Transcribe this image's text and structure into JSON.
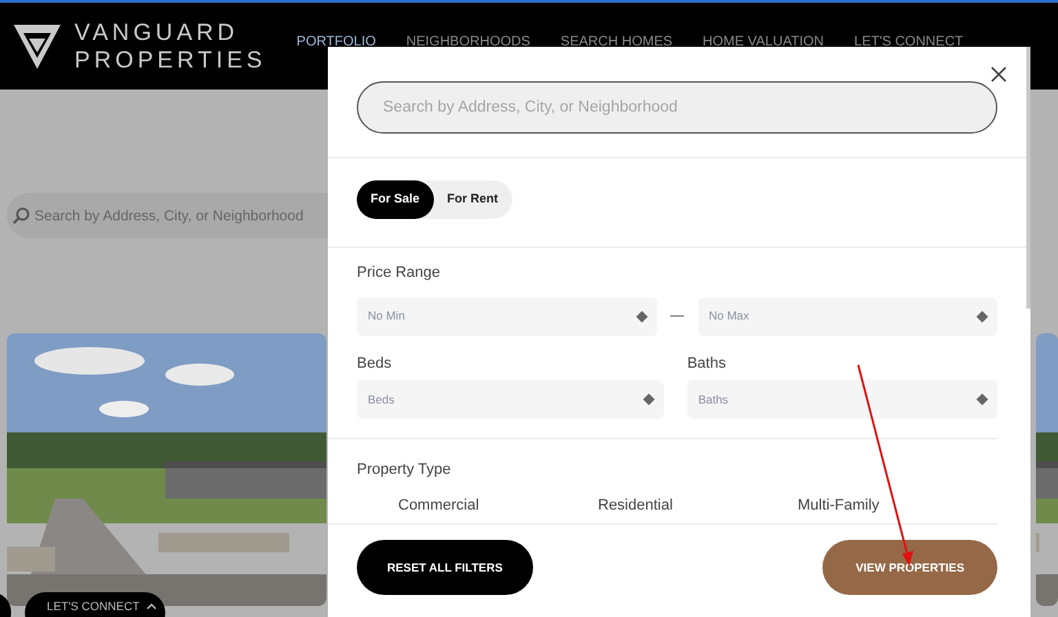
{
  "header": {
    "logo": {
      "line1": "VANGUARD",
      "line2": "PROPERTIES"
    },
    "nav": [
      {
        "label": "PORTFOLIO",
        "selected": true
      },
      {
        "label": "NEIGHBORHOODS",
        "selected": false
      },
      {
        "label": "SEARCH HOMES",
        "selected": false
      },
      {
        "label": "HOME VALUATION",
        "selected": false
      },
      {
        "label": "LET'S CONNECT",
        "selected": false
      }
    ]
  },
  "page": {
    "search": {
      "placeholder": "Search by Address, City, or Neighborhood"
    },
    "lets_connect": "LET'S CONNECT"
  },
  "filter_modal": {
    "search": {
      "placeholder": "Search by Address, City, or Neighborhood"
    },
    "listing_types": [
      {
        "label": "For Sale",
        "selected": true
      },
      {
        "label": "For Rent",
        "selected": false
      }
    ],
    "price_range": {
      "label": "Price Range",
      "min": {
        "placeholder": "No Min"
      },
      "separator": "—",
      "max": {
        "placeholder": "No Max"
      }
    },
    "beds": {
      "label": "Beds",
      "placeholder": "Beds"
    },
    "baths": {
      "label": "Baths",
      "placeholder": "Baths"
    },
    "property_type": {
      "label": "Property Type",
      "options": [
        "Commercial",
        "Residential",
        "Multi-Family"
      ]
    },
    "buttons": [
      {
        "label": "RESET ALL FILTERS",
        "kind": "secondary"
      },
      {
        "label": "VIEW PROPERTIES",
        "kind": "primary"
      }
    ]
  }
}
